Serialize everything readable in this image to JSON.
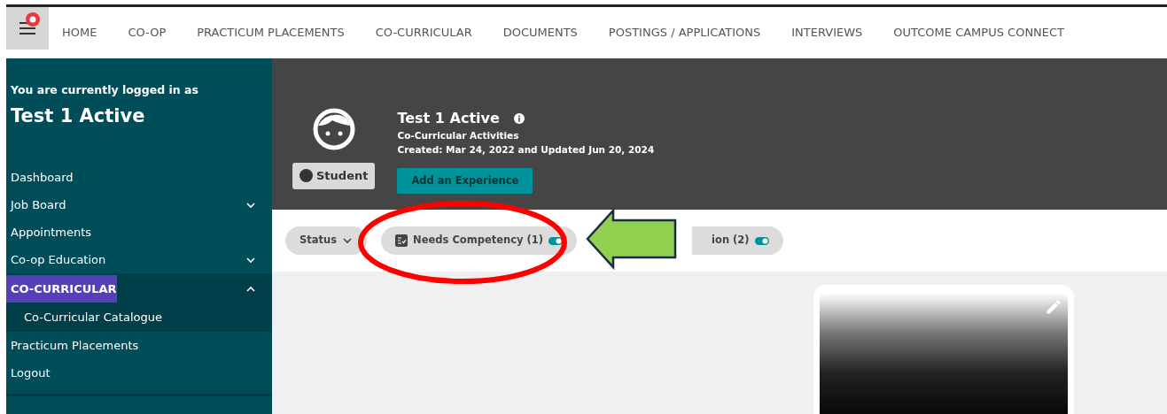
{
  "topnav": {
    "notification": true,
    "items": [
      {
        "label": "HOME"
      },
      {
        "label": "CO-OP"
      },
      {
        "label": "PRACTICUM PLACEMENTS"
      },
      {
        "label": "CO-CURRICULAR"
      },
      {
        "label": "DOCUMENTS"
      },
      {
        "label": "POSTINGS / APPLICATIONS"
      },
      {
        "label": "INTERVIEWS"
      },
      {
        "label": "OUTCOME CAMPUS CONNECT"
      }
    ]
  },
  "sidebar": {
    "intro": "You are currently logged in as",
    "user": "Test 1 Active",
    "items": [
      {
        "label": "Dashboard",
        "selected": false
      },
      {
        "label": "Job Board",
        "expanded": false,
        "selected": false
      },
      {
        "label": "Appointments",
        "selected": false
      },
      {
        "label": "Co-op Education",
        "expanded": false,
        "selected": false
      },
      {
        "label": "CO-CURRICULAR",
        "expanded": true,
        "selected": true,
        "children": [
          {
            "label": "Co-Curricular Catalogue"
          }
        ]
      },
      {
        "label": "Practicum Placements",
        "selected": false
      },
      {
        "label": "Logout",
        "selected": false
      }
    ]
  },
  "profile": {
    "name": "Test 1 Active",
    "subtitle": "Co-Curricular Activities",
    "dates": "Created: Mar 24, 2022 and Updated Jun 20, 2024",
    "role": "Student",
    "action": "Add an Experience"
  },
  "filters": [
    {
      "kind": "dropdown",
      "label": "Status"
    },
    {
      "kind": "toggle",
      "label": "Needs Competency (1)",
      "on": true
    },
    {
      "kind": "toggle",
      "label": "ion (2)",
      "on": true
    }
  ],
  "annotations": [
    {
      "kind": "ellipse",
      "color": "#ff0000"
    },
    {
      "kind": "arrow",
      "color": "#92d050"
    }
  ]
}
